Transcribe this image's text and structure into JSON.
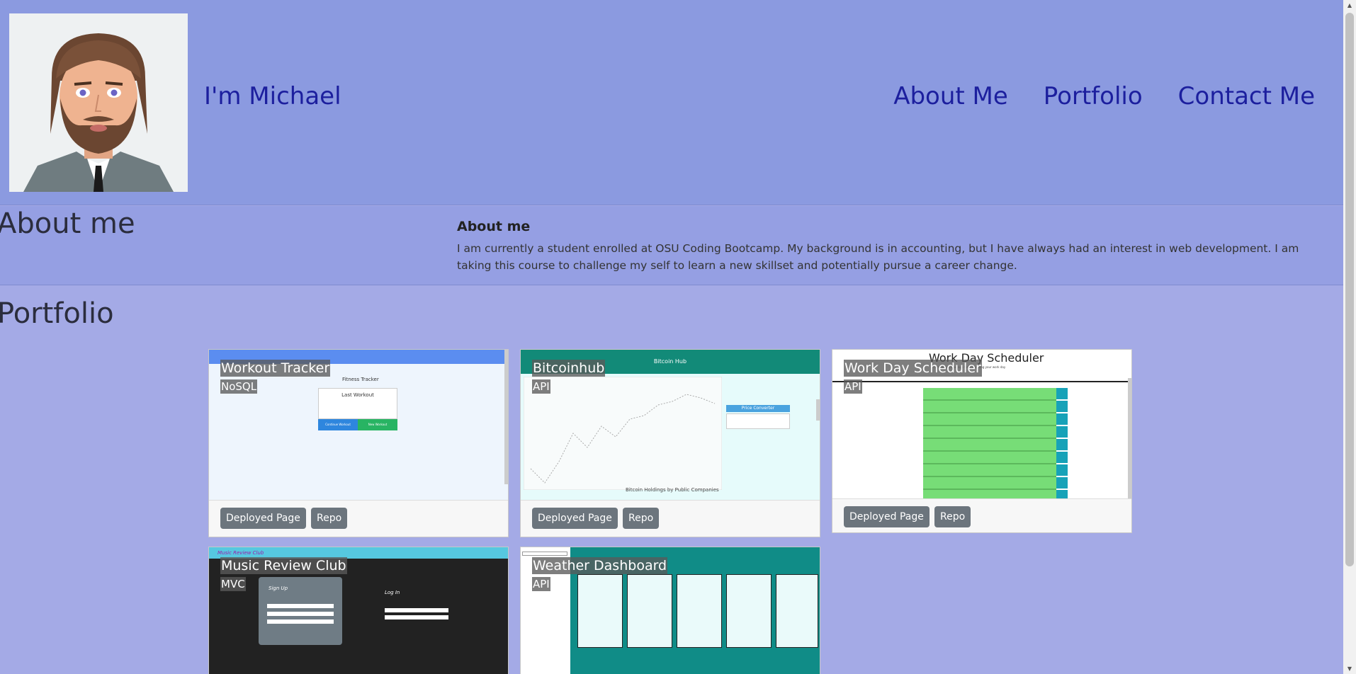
{
  "header": {
    "avatar_icon": "cartoon-man-avatar",
    "brand": "I'm Michael",
    "nav": [
      "About Me",
      "Portfolio",
      "Contact Me"
    ]
  },
  "about": {
    "heading": "About me",
    "subheading": "About me",
    "text": "I am currently a student enrolled at OSU Coding Bootcamp. My background is in accounting, but I have always had an interest in web development. I am taking this course to challenge my self to learn a new skillset and potentially pursue a career change."
  },
  "portfolio": {
    "heading": "Portfolio",
    "deployed_label": "Deployed Page",
    "repo_label": "Repo",
    "projects": [
      {
        "title": "Workout Tracker",
        "tag": "NoSQL",
        "shot": {
          "header": "Fitness Tracker",
          "card_title": "Last Workout",
          "btn1": "Continue Workout",
          "btn2": "New Workout"
        }
      },
      {
        "title": "Bitcoinhub",
        "tag": "API",
        "shot": {
          "header": "Bitcoin Hub",
          "side": "Price Converter",
          "caption": "Bitcoin Holdings by Public Companies"
        }
      },
      {
        "title": "Work Day Scheduler",
        "tag": "API",
        "shot": {
          "header": "Work Day Scheduler",
          "sub": "A simple calendar app for scheduling your work day",
          "save": "Save"
        }
      },
      {
        "title": "Music Review Club",
        "tag": "MVC",
        "shot": {
          "header": "Music Review Club",
          "signup": "Sign Up",
          "login": "Log In"
        }
      },
      {
        "title": "Weather Dashboard",
        "tag": "API",
        "shot": {}
      }
    ]
  },
  "colors": {
    "header_bg": "#8b9ae0",
    "page_bg": "#a4aae6",
    "link": "#1c1f9e",
    "button": "#6c757d"
  }
}
